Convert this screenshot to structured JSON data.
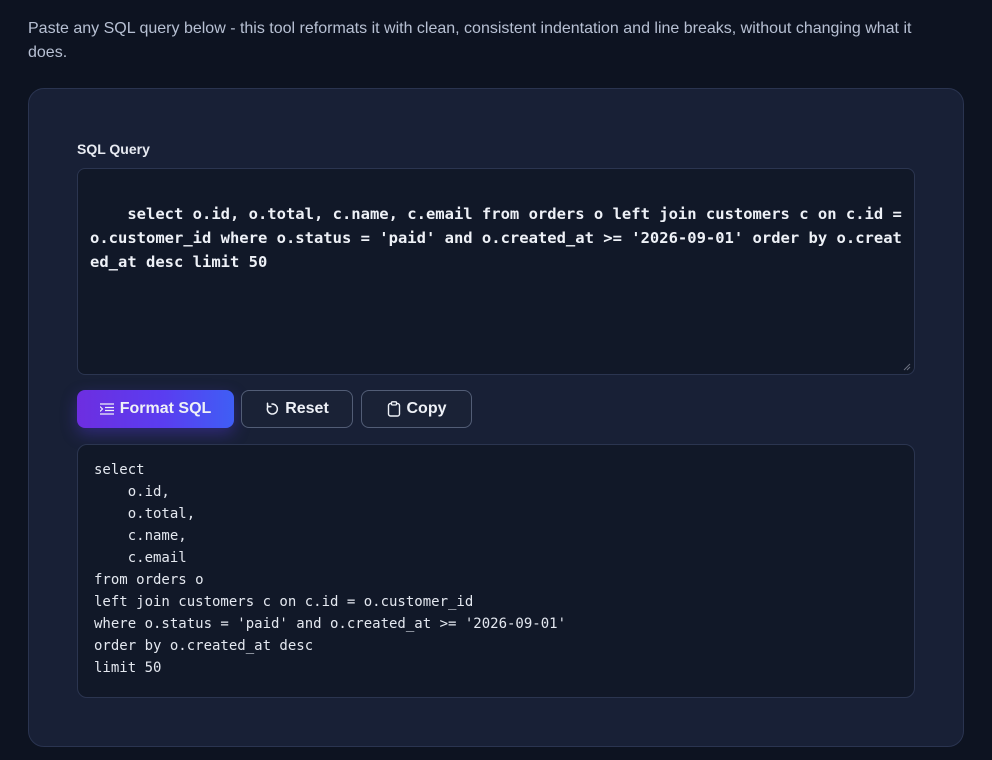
{
  "intro": "Paste any SQL query below - this tool reformats it with clean, consistent indentation and line breaks, without changing what it does.",
  "form": {
    "label": "SQL Query",
    "input_value": "select o.id, o.total, c.name, c.email from orders o left join customers c on c.id = o.customer_id where o.status = 'paid' and o.created_at >= '2026-09-01' order by o.created_at desc limit 50"
  },
  "buttons": {
    "format": {
      "label": "Format SQL",
      "icon": "format-indent-icon"
    },
    "reset": {
      "label": "Reset",
      "icon": "refresh-icon"
    },
    "copy": {
      "label": "Copy",
      "icon": "clipboard-icon"
    }
  },
  "output": {
    "lines": [
      "select",
      "    o.id,",
      "    o.total,",
      "    c.name,",
      "    c.email",
      "from orders o",
      "left join customers c on c.id = o.customer_id",
      "where o.status = 'paid' and o.created_at >= '2026-09-01'",
      "order by o.created_at desc",
      "limit 50"
    ]
  },
  "colors": {
    "background": "#0d1321",
    "card": "#182036",
    "accent_start": "#6d2ee0",
    "accent_end": "#3f5ef5"
  }
}
